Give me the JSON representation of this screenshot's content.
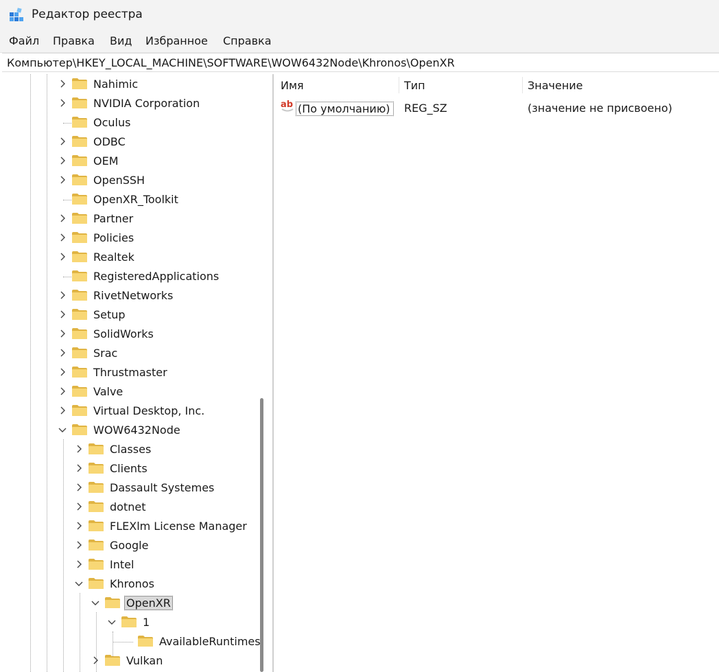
{
  "window": {
    "title": "Редактор реестра",
    "icon": "registry-editor-icon"
  },
  "menu": [
    "Файл",
    "Правка",
    "Вид",
    "Избранное",
    "Справка"
  ],
  "address": "Компьютер\\HKEY_LOCAL_MACHINE\\SOFTWARE\\WOW6432Node\\Khronos\\OpenXR",
  "tree": [
    {
      "label": "Nahimic",
      "expander": "collapsed"
    },
    {
      "label": "NVIDIA Corporation",
      "expander": "collapsed"
    },
    {
      "label": "Oculus",
      "expander": "none"
    },
    {
      "label": "ODBC",
      "expander": "collapsed"
    },
    {
      "label": "OEM",
      "expander": "collapsed"
    },
    {
      "label": "OpenSSH",
      "expander": "collapsed"
    },
    {
      "label": "OpenXR_Toolkit",
      "expander": "none"
    },
    {
      "label": "Partner",
      "expander": "collapsed"
    },
    {
      "label": "Policies",
      "expander": "collapsed"
    },
    {
      "label": "Realtek",
      "expander": "collapsed"
    },
    {
      "label": "RegisteredApplications",
      "expander": "none"
    },
    {
      "label": "RivetNetworks",
      "expander": "collapsed"
    },
    {
      "label": "Setup",
      "expander": "collapsed"
    },
    {
      "label": "SolidWorks",
      "expander": "collapsed"
    },
    {
      "label": "Srac",
      "expander": "collapsed"
    },
    {
      "label": "Thrustmaster",
      "expander": "collapsed"
    },
    {
      "label": "Valve",
      "expander": "collapsed"
    },
    {
      "label": "Virtual Desktop, Inc.",
      "expander": "collapsed"
    },
    {
      "label": "WOW6432Node",
      "expander": "expanded"
    },
    {
      "label": "Classes",
      "expander": "collapsed"
    },
    {
      "label": "Clients",
      "expander": "collapsed"
    },
    {
      "label": "Dassault Systemes",
      "expander": "collapsed"
    },
    {
      "label": "dotnet",
      "expander": "collapsed"
    },
    {
      "label": "FLEXlm License Manager",
      "expander": "collapsed"
    },
    {
      "label": "Google",
      "expander": "collapsed"
    },
    {
      "label": "Intel",
      "expander": "collapsed"
    },
    {
      "label": "Khronos",
      "expander": "expanded"
    },
    {
      "label": "OpenXR",
      "expander": "expanded",
      "selected": true
    },
    {
      "label": "1",
      "expander": "expanded"
    },
    {
      "label": "AvailableRuntimes",
      "expander": "none"
    },
    {
      "label": "Vulkan",
      "expander": "collapsed"
    }
  ],
  "columns": {
    "name": "Имя",
    "type": "Тип",
    "value": "Значение"
  },
  "values": [
    {
      "name": "(По умолчанию)",
      "type": "REG_SZ",
      "data": "(значение не присвоено)",
      "icon": "string-value-icon"
    }
  ],
  "colors": {
    "folder": "#f8d775",
    "folder_edge": "#e0b443",
    "selection": "#d9d9d9"
  }
}
